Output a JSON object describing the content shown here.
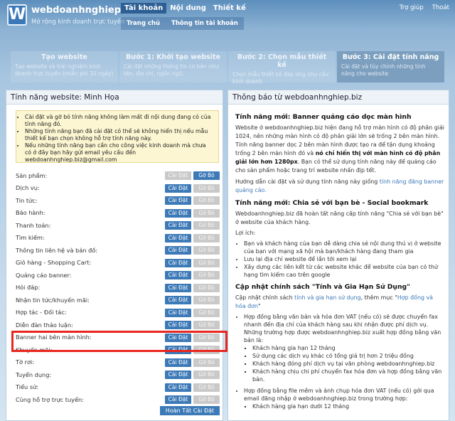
{
  "header": {
    "logo_letter": "W",
    "site_name": "webdoanhnghiep.biz",
    "tagline": "Mở rộng kinh doanh trực tuyến",
    "top_nav": [
      "Tài khoản",
      "Nội dung",
      "Thiết kế"
    ],
    "sub_nav": [
      "Trang chủ",
      "Thông tin tài khoản"
    ],
    "util": [
      "Trợ giúp",
      "Thoát"
    ]
  },
  "steps": [
    {
      "title": "Tạo website",
      "desc": "Tạo website và trải nghiệm kinh doanh trực tuyến (miễn phí 30 ngày)"
    },
    {
      "title": "Bước 1: Khởi tạo website",
      "desc": "Cài đặt những thông tin cơ bản như tên, địa chỉ, ngôn ngữ."
    },
    {
      "title": "Bước 2: Chọn mẫu thiết kế",
      "desc": "Chọn mẫu thiết kế đáp ứng nhu cầu kinh doanh"
    },
    {
      "title": "Bước 3: Cài đặt tính năng",
      "desc": "Cài đặt và tùy chỉnh những tính năng cho website"
    }
  ],
  "left": {
    "title": "Tính năng website: Minh Họa",
    "notice": [
      "Cài đặt và gỡ bỏ tính năng không làm mất đi nội dung đang có của tính năng đó.",
      "Những tính năng bạn đã cài đặt có thể sẽ không hiển thị nếu mẫu thiết kế bạn chọn không hỗ trợ tính năng này.",
      "Nếu những tính năng bạn cần cho công việc kinh doanh mà chưa có ở đây bạn hãy gửi email yêu cầu đến webdoanhnghiep.biz@gmail.com"
    ],
    "install_label": "Cài Đặt",
    "remove_label": "Gỡ Bỏ",
    "features": [
      {
        "name": "Sản phẩm:",
        "installed": true
      },
      {
        "name": "Dịch vụ:",
        "installed": false
      },
      {
        "name": "Tin tức:",
        "installed": false
      },
      {
        "name": "Bảo hành:",
        "installed": false
      },
      {
        "name": "Thanh toán:",
        "installed": false
      },
      {
        "name": "Tìm kiếm:",
        "installed": false
      },
      {
        "name": "Thông tin liên hệ và bản đồ:",
        "installed": false
      },
      {
        "name": "Giỏ hàng - Shopping Cart:",
        "installed": false
      },
      {
        "name": "Quảng cáo banner:",
        "installed": false
      },
      {
        "name": "Hỏi đáp:",
        "installed": false
      },
      {
        "name": "Nhận tin tức/khuyến mãi:",
        "installed": false
      },
      {
        "name": "Hợp tác - Đối tác:",
        "installed": false
      },
      {
        "name": "Diễn đàn thảo luận:",
        "installed": false
      },
      {
        "name": "Banner hai bên màn hình:",
        "installed": false
      },
      {
        "name": "Khuyến mãi:",
        "installed": false
      },
      {
        "name": "Tờ rơi:",
        "installed": false
      },
      {
        "name": "Tuyển dụng:",
        "installed": false
      },
      {
        "name": "Tiểu sử:",
        "installed": false
      },
      {
        "name": "Cùng hỗ trợ trực tuyến:",
        "installed": false
      }
    ],
    "finish_label": "Hoàn Tất Cài Đặt"
  },
  "right": {
    "title": "Thông báo từ webdoanhnghiep.biz",
    "s1_title": "Tính năng mới: Banner quảng cáo dọc màn hình",
    "s1_p1": "Website ở webdoanhnghiep.biz hiện đang hỗ trợ màn hình có độ phân giải 1024, nên những màn hình có độ phân giải lớn sẽ trống 2 bên màn hình. Tính năng banner dọc 2 bên màn hình được tạo ra để tận dụng khoảng trống 2 bên màn hình đó và",
    "s1_bold": "nó chỉ hiển thị với màn hình có độ phân giải lớn hơn 1280px",
    "s1_p1b": ". Bạn có thể sử dụng tính năng này để quảng cáo cho sản phẩm hoặc trang trí website nhấn địp tết.",
    "s1_p2": "Hướng dẫn cài đặt và sử dụng tính năng này giống",
    "s1_link": "tính năng đăng banner quảng cáo.",
    "s2_title": "Tính năng mới: Chia sẻ với bạn bè - Social bookmark",
    "s2_p1": "Webdoanhnghiep.biz đã hoàn tất nâng cấp tính năng \"Chia sẻ với bạn bè\" ở website của khách hàng.",
    "s2_p2": "Lợi ích:",
    "s2_list": [
      "Bạn và khách hàng của bạn dễ dàng chia sẻ nội dung thú vị ở website của bạn với mạng xã hội mà bạn/khách hàng đang tham gia",
      "Lưu lại địa chỉ website để lần tới xem lại",
      "Xây dựng các liên kết từ các website khác để website của bạn có thứ hạng tìm kiếm cao trên google"
    ],
    "s3_title": "Cập nhật chính sách \"Tính và Gia Hạn Sử Dụng\"",
    "s3_p1a": "Cập nhật chính sách",
    "s3_link1": "tính và gia hạn sử dụng",
    "s3_p1b": ", thêm mục \"",
    "s3_link2": "Hợp đồng và hóa đơn",
    "s3_p1c": "\"",
    "s3_item1": "Hợp đồng bằng văn bản và hóa đơn VAT (nếu có) sẽ được chuyển fax nhanh đến địa chỉ của khách hàng sau khi nhận được phí dịch vụ. Những trường hợp được webdoanhnghiep.biz xuất hợp đồng bằng văn bản là:",
    "s3_sub1": [
      "Khách hàng gia hạn 12 tháng",
      "Sử dụng các dịch vụ khác có tổng giá trị hơn 2 triệu đồng",
      "Khách hàng đóng phí dịch vụ tại văn phòng webdoanhnghiep.biz",
      "Khách hàng chịu chi phí chuyển fax hóa đơn và hợp đồng bằng văn bản."
    ],
    "s3_item2": "Hợp đồng bằng file mềm và ảnh chụp hóa đơn VAT (nếu có) gởi qua email đăng nhập ở webdoanhnghiep.biz trong trường hợp:",
    "s3_sub2": [
      "Khách hàng gia hạn dưới 12 tháng"
    ]
  },
  "colors": {
    "accent": "#3c79b7",
    "highlight": "#e8261e",
    "notice_bg": "#fcf6d2"
  }
}
